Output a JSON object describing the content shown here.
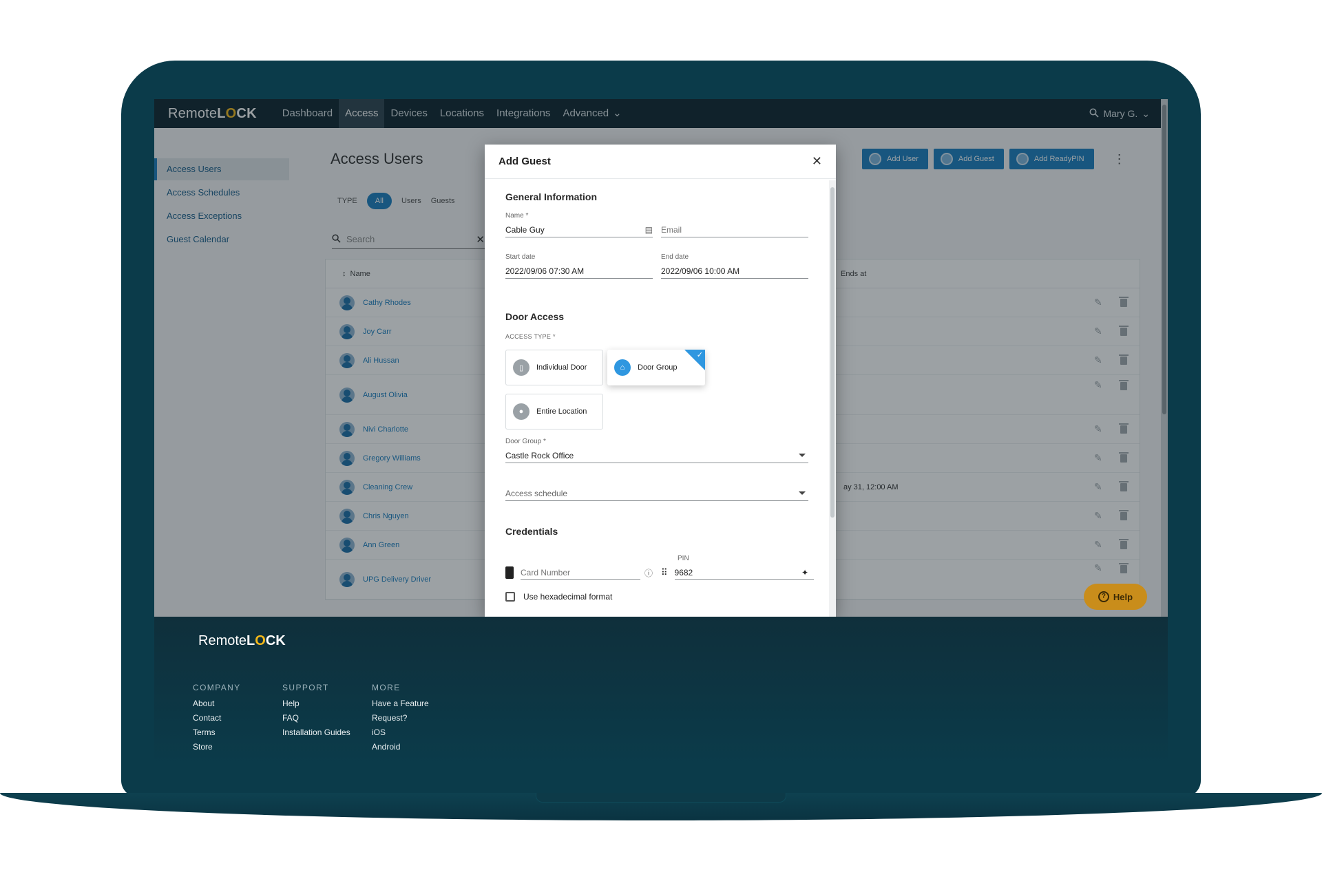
{
  "app": {
    "logo_text": "Remote",
    "logo_lock_a": "L",
    "logo_lock_o": "O",
    "logo_lock_b": "CK"
  },
  "nav": {
    "items": [
      "Dashboard",
      "Access",
      "Devices",
      "Locations",
      "Integrations"
    ],
    "advanced": "Advanced",
    "user": "Mary G."
  },
  "sidebar": {
    "items": [
      "Access Users",
      "Access Schedules",
      "Access Exceptions",
      "Guest Calendar"
    ]
  },
  "main": {
    "title": "Access Users",
    "type_label": "TYPE",
    "type_filters": [
      "All",
      "Users",
      "Guests"
    ],
    "search_placeholder": "Search",
    "actions": [
      "Add User",
      "Add Guest",
      "Add ReadyPIN"
    ],
    "columns": {
      "name": "Name",
      "ends_at": "Ends at"
    },
    "rows": [
      {
        "name": "Cathy Rhodes",
        "ends": ""
      },
      {
        "name": "Joy Carr",
        "ends": ""
      },
      {
        "name": "Ali Hussan",
        "ends": ""
      },
      {
        "name": "August Olivia",
        "ends": ""
      },
      {
        "name": "Nivi Charlotte",
        "ends": ""
      },
      {
        "name": "Gregory Williams",
        "ends": ""
      },
      {
        "name": "Cleaning Crew",
        "ends": "ay 31, 12:00 AM"
      },
      {
        "name": "Chris Nguyen",
        "ends": ""
      },
      {
        "name": "Ann Green",
        "ends": ""
      },
      {
        "name": "UPG Delivery Driver",
        "ends": ""
      }
    ],
    "help": "Help"
  },
  "modal": {
    "title": "Add Guest",
    "general": {
      "title": "General Information",
      "name_label": "Name *",
      "name_value": "Cable Guy",
      "email_placeholder": "Email",
      "start_label": "Start date",
      "start_value": "2022/09/06 07:30 AM",
      "end_label": "End date",
      "end_value": "2022/09/06 10:00 AM"
    },
    "door_access": {
      "title": "Door Access",
      "access_type_label": "ACCESS TYPE *",
      "options": [
        "Individual Door",
        "Door Group",
        "Entire Location"
      ],
      "selected": "Door Group",
      "door_group_label": "Door Group *",
      "door_group_value": "Castle Rock Office",
      "schedule_placeholder": "Access schedule"
    },
    "credentials": {
      "title": "Credentials",
      "card_placeholder": "Card Number",
      "pin_label": "PIN",
      "pin_value": "9682",
      "hex_label": "Use hexadecimal format"
    }
  },
  "footer": {
    "columns": [
      {
        "heading": "COMPANY",
        "links": [
          "About",
          "Contact",
          "Terms",
          "Store"
        ]
      },
      {
        "heading": "SUPPORT",
        "links": [
          "Help",
          "FAQ",
          "Installation Guides"
        ]
      },
      {
        "heading": "MORE",
        "links": [
          "Have a Feature",
          "Request?",
          "iOS",
          "Android"
        ]
      }
    ]
  },
  "colors": {
    "frame": "#0b3b4a",
    "topbar": "#0f2530",
    "accent": "#1c7fc0",
    "selected_blue": "#2f97e0",
    "help": "#c98d1b",
    "logo_yellow": "#f3b81a"
  }
}
